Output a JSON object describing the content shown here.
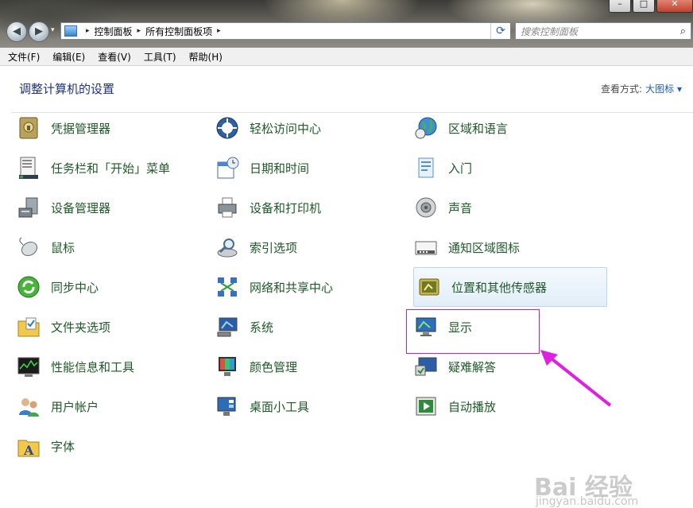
{
  "window": {
    "minimize": "–",
    "maximize": "□",
    "close": "✕"
  },
  "nav": {
    "back": "◀",
    "forward": "▶",
    "dropdown": "▾"
  },
  "address": {
    "crumbs": [
      "控制面板",
      "所有控制面板项"
    ],
    "sep": "▸",
    "dropdown": "▾",
    "refresh": "⟳"
  },
  "search": {
    "placeholder": "搜索控制面板",
    "icon": "search-icon",
    "glyph": "⌕"
  },
  "menu": [
    "文件(F)",
    "编辑(E)",
    "查看(V)",
    "工具(T)",
    "帮助(H)"
  ],
  "page": {
    "heading": "调整计算机的设置",
    "view_by_label": "查看方式:",
    "view_by_value": "大图标 ▾"
  },
  "items": {
    "col1": [
      {
        "label": "凭据管理器",
        "icon": "vault-icon"
      },
      {
        "label": "任务栏和「开始」菜单",
        "icon": "taskbar-icon"
      },
      {
        "label": "设备管理器",
        "icon": "device-manager-icon"
      },
      {
        "label": "鼠标",
        "icon": "mouse-icon"
      },
      {
        "label": "同步中心",
        "icon": "sync-icon"
      },
      {
        "label": "文件夹选项",
        "icon": "folder-options-icon"
      },
      {
        "label": "性能信息和工具",
        "icon": "performance-icon"
      },
      {
        "label": "用户帐户",
        "icon": "users-icon"
      },
      {
        "label": "字体",
        "icon": "fonts-icon"
      }
    ],
    "col2": [
      {
        "label": "轻松访问中心",
        "icon": "ease-of-access-icon"
      },
      {
        "label": "日期和时间",
        "icon": "calendar-clock-icon"
      },
      {
        "label": "设备和打印机",
        "icon": "printer-icon"
      },
      {
        "label": "索引选项",
        "icon": "indexing-icon"
      },
      {
        "label": "网络和共享中心",
        "icon": "network-icon"
      },
      {
        "label": "系统",
        "icon": "system-icon"
      },
      {
        "label": "颜色管理",
        "icon": "color-management-icon"
      },
      {
        "label": "桌面小工具",
        "icon": "gadgets-icon"
      }
    ],
    "col3": [
      {
        "label": "区域和语言",
        "icon": "globe-clock-icon"
      },
      {
        "label": "入门",
        "icon": "getting-started-icon"
      },
      {
        "label": "声音",
        "icon": "speaker-icon"
      },
      {
        "label": "通知区域图标",
        "icon": "notification-area-icon"
      },
      {
        "label": "位置和其他传感器",
        "icon": "sensor-icon"
      },
      {
        "label": "显示",
        "icon": "display-icon"
      },
      {
        "label": "疑难解答",
        "icon": "troubleshoot-icon"
      },
      {
        "label": "自动播放",
        "icon": "autoplay-icon"
      }
    ]
  },
  "watermark": {
    "brand": "Bai 经验",
    "url": "jingyan.baidu.com"
  },
  "colors": {
    "item_text": "#1e5a28",
    "heading": "#1e3287",
    "link": "#1e5bb7",
    "callout": "#c020d0"
  }
}
